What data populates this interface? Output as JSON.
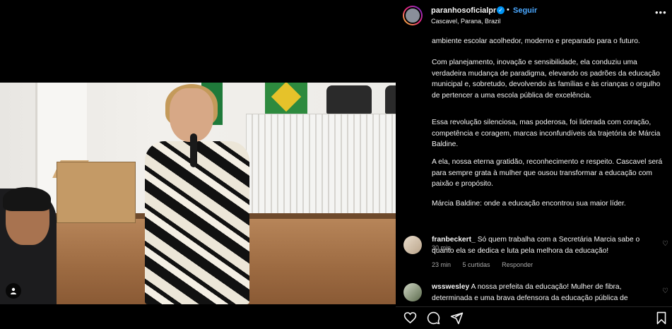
{
  "post": {
    "username": "paranhosoficialpr",
    "follow_label": "Seguir",
    "dot": "•",
    "location": "Cascavel, Parana, Brazil",
    "more": "•••"
  },
  "caption": {
    "p1": "ambiente escolar acolhedor, moderno e preparado para o futuro.",
    "p2": "Com planejamento, inovação e sensibilidade, ela conduziu uma verdadeira mudança de paradigma, elevando os padrões da educação municipal e, sobretudo, devolvendo às famílias e às crianças o orgulho de pertencer a uma escola pública de excelência.",
    "p3": "Essa revolução silenciosa, mas poderosa, foi liderada com coração, competência e coragem, marcas inconfundíveis da trajetória de Márcia Baldine.",
    "p4": "A ela, nossa eterna gratidão, reconhecimento e respeito. Cascavel será para sempre grata à mulher que ousou transformar a educação com paixão e propósito.",
    "p5": "Márcia Baldine: onde a educação encontrou sua maior líder.",
    "time": "30 min"
  },
  "comments": [
    {
      "user": "franbeckert_",
      "text": "Só quem trabalha com a Secretária Marcia sabe o quanto ela se dedica e luta pela melhora da educação!",
      "time": "23 min",
      "likes": "5 curtidas",
      "reply": "Responder"
    },
    {
      "user": "wsswesley",
      "text": "A nossa prefeita da educação! Mulher de fibra, determinada e uma brava defensora da educação pública de"
    }
  ],
  "icons": {
    "heart": "heart-icon",
    "comment": "comment-icon",
    "share": "share-icon",
    "save": "bookmark-icon",
    "tag": "user-tag-icon",
    "verified": "verified-badge-icon"
  },
  "colors": {
    "background": "#000000",
    "link": "#4aa8ff",
    "verified": "#0095f6",
    "muted": "#a8a8a8"
  }
}
